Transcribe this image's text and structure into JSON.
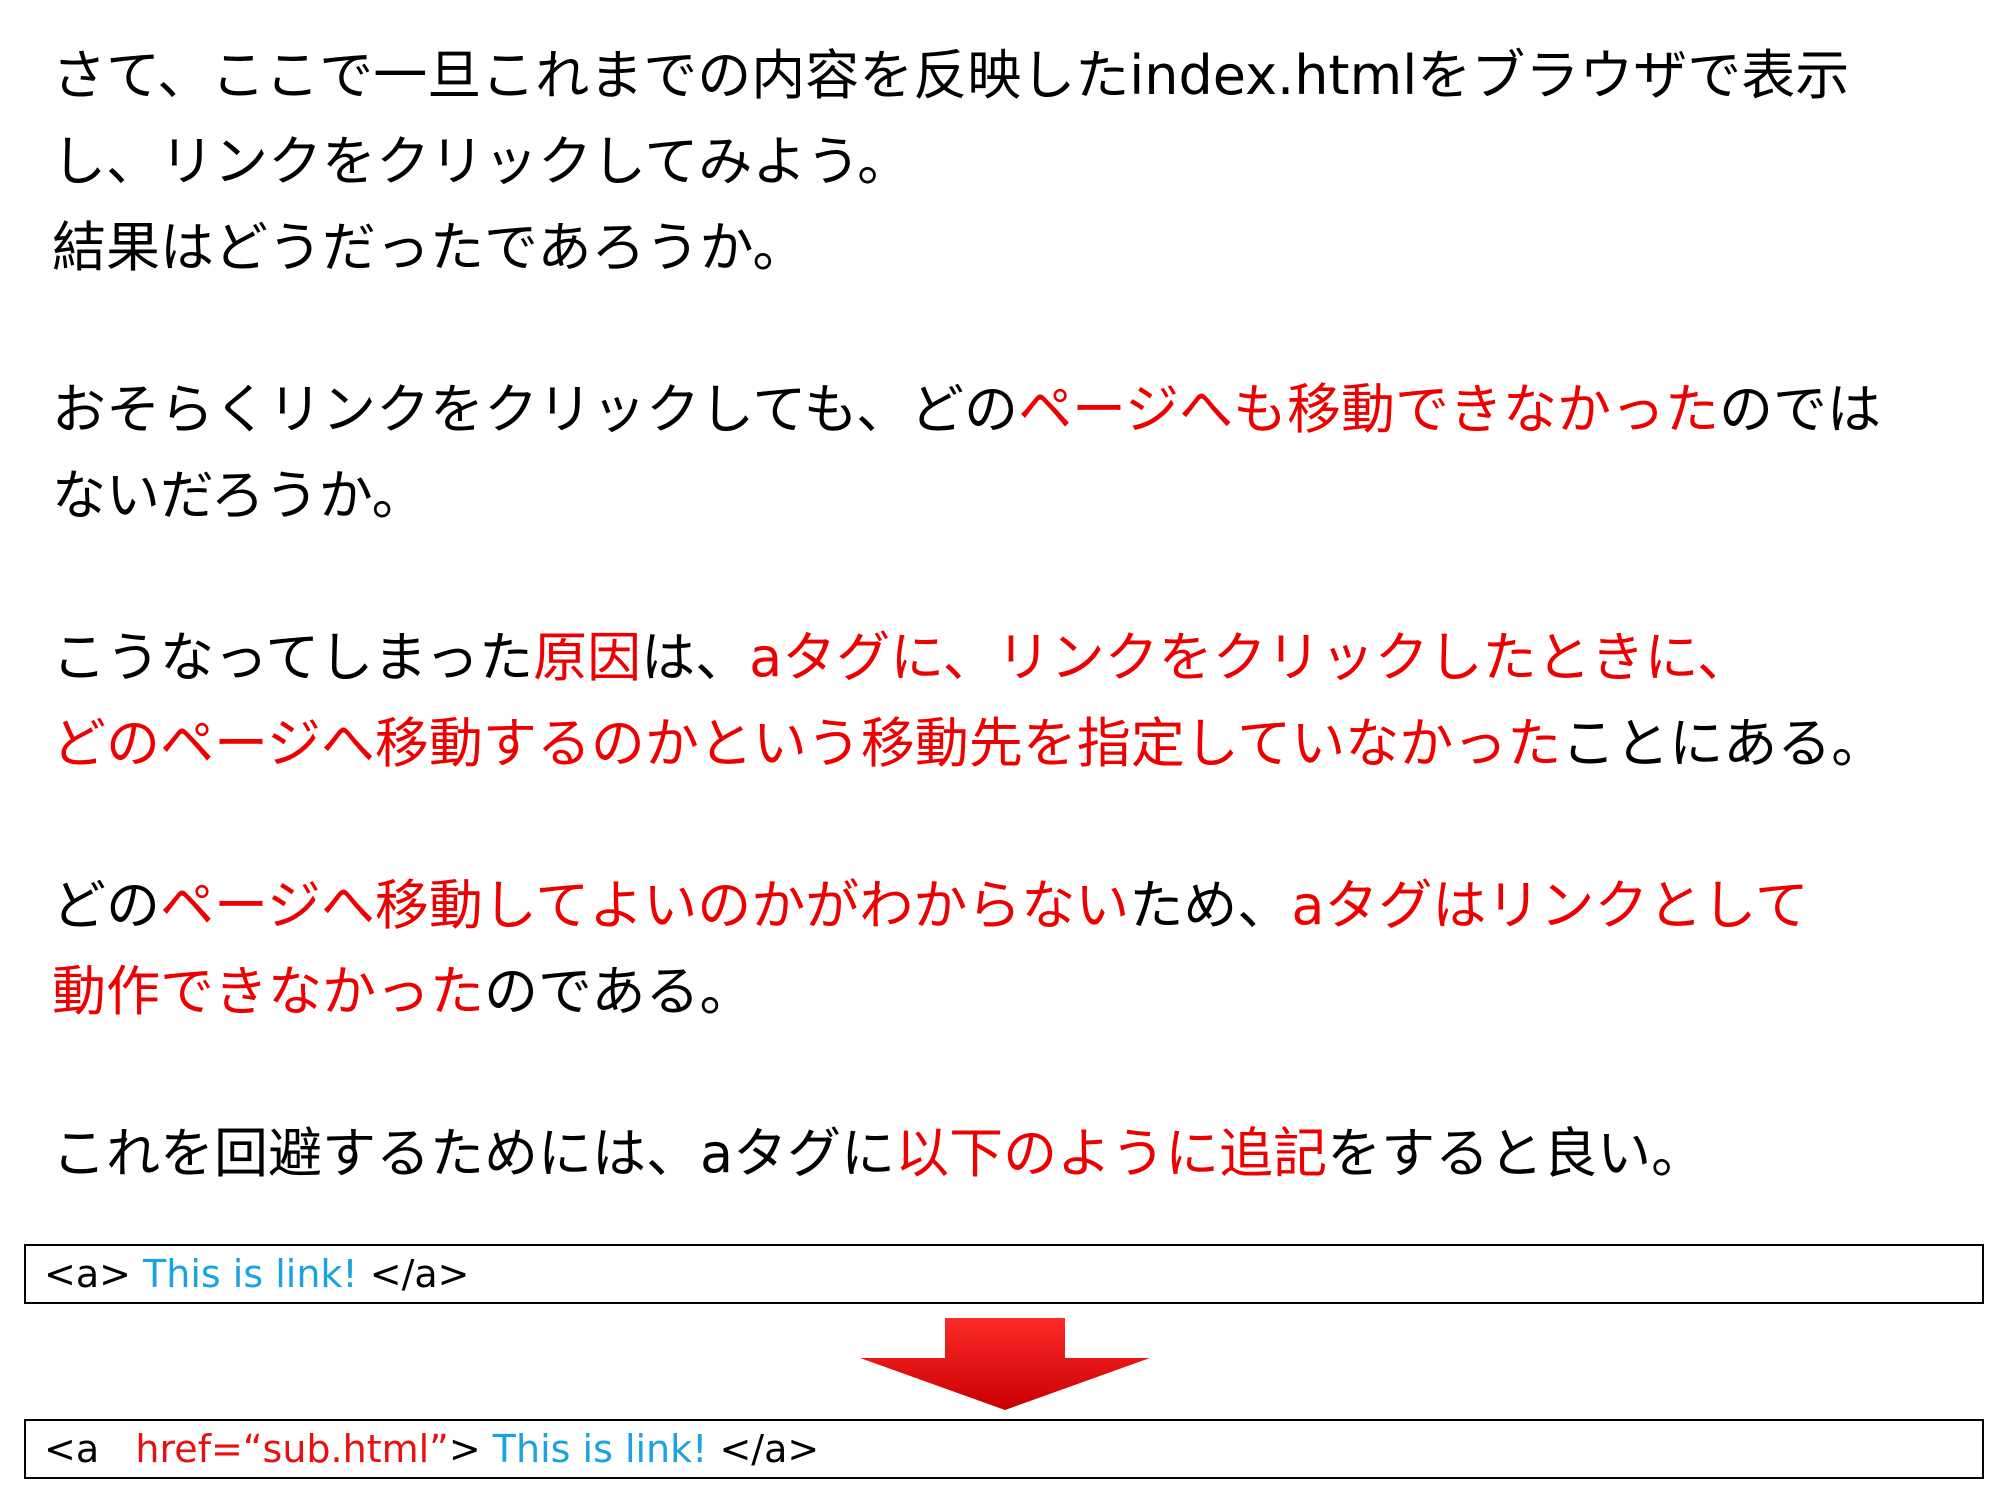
{
  "paragraphs": {
    "p1": {
      "l1": "さて、ここで一旦これまでの内容を反映したindex.htmlをブラウザで表示",
      "l2": "し、リンクをクリックしてみよう。",
      "l3": "結果はどうだったであろうか。"
    },
    "p2": {
      "l1_a": "おそらくリンクをクリックしても、どの",
      "l1_b": "ページへも移動できなかった",
      "l1_c": "のでは",
      "l2": "ないだろうか。"
    },
    "p3": {
      "l1_a": "こうなってしまった",
      "l1_b": "原因",
      "l1_c": "は、",
      "l1_d": "aタグに、リンクをクリックしたときに、",
      "l2_a": "どのページへ移動するのかという移動先を指定していなかった",
      "l2_b": "ことにある。"
    },
    "p4": {
      "l1_a": "どの",
      "l1_b": "ページへ移動してよいのかがわからない",
      "l1_c": "ため、",
      "l1_d": "aタグはリンクとして",
      "l2_a": "動作できなかった",
      "l2_b": "のである。"
    },
    "p5": {
      "l1_a": "これを回避するためには、aタグに",
      "l1_b": "以下のように追記",
      "l1_c": "をすると良い。"
    }
  },
  "code_before": {
    "open": "<a> ",
    "text": "This is link!",
    "close": " </a>"
  },
  "code_after": {
    "open": "<a   ",
    "attr": "href=“sub.html”",
    "gt": "> ",
    "text": "This is link!",
    "close": " </a>"
  },
  "colors": {
    "emphasis": "#ee0000",
    "link_text": "#1aa3e0",
    "arrow": "#e00000"
  },
  "icons": {
    "arrow": "down-arrow-icon"
  }
}
